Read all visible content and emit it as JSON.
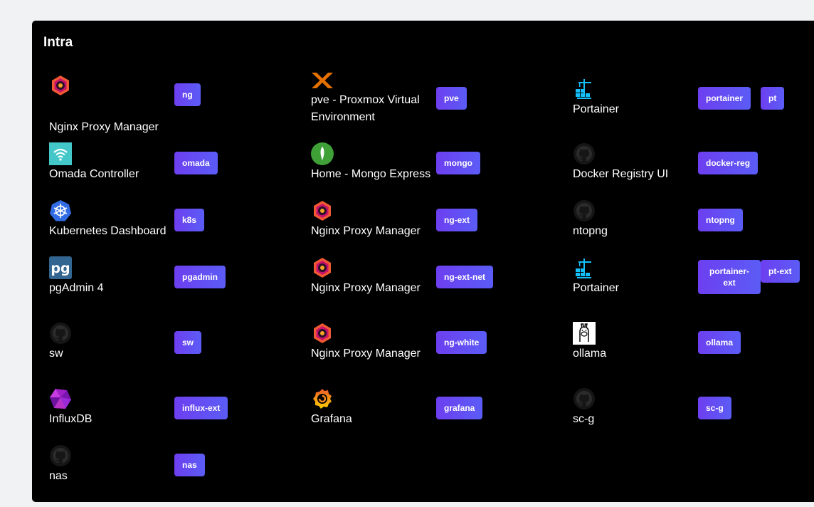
{
  "section": {
    "title": "Intra"
  },
  "apps": [
    {
      "name": "Nginx Proxy Manager",
      "icon": "nginx-proxy-manager-icon",
      "tags": [
        "ng"
      ]
    },
    {
      "name": "pve - Proxmox Virtual Environment",
      "icon": "proxmox-icon",
      "tags": [
        "pve"
      ]
    },
    {
      "name": "Portainer",
      "icon": "portainer-icon",
      "tags": [
        "portainer",
        "pt"
      ]
    },
    {
      "name": "Omada Controller",
      "icon": "omada-wifi-icon",
      "tags": [
        "omada"
      ]
    },
    {
      "name": "Home - Mongo Express",
      "icon": "mongodb-leaf-icon",
      "tags": [
        "mongo"
      ]
    },
    {
      "name": "Docker Registry UI",
      "icon": "github-icon",
      "tags": [
        "docker-reg"
      ]
    },
    {
      "name": "Kubernetes Dashboard",
      "icon": "kubernetes-icon",
      "tags": [
        "k8s"
      ]
    },
    {
      "name": "Nginx Proxy Manager",
      "icon": "nginx-proxy-manager-icon",
      "tags": [
        "ng-ext"
      ]
    },
    {
      "name": "ntopng",
      "icon": "github-icon",
      "tags": [
        "ntopng"
      ]
    },
    {
      "name": "pgAdmin 4",
      "icon": "pgadmin-icon",
      "tags": [
        "pgadmin"
      ]
    },
    {
      "name": "Nginx Proxy Manager",
      "icon": "nginx-proxy-manager-icon",
      "tags": [
        "ng-ext-net"
      ]
    },
    {
      "name": "Portainer",
      "icon": "portainer-icon",
      "tags": [
        "portainer-ext",
        "pt-ext"
      ]
    },
    {
      "name": "sw",
      "icon": "github-icon",
      "tags": [
        "sw"
      ]
    },
    {
      "name": "Nginx Proxy Manager",
      "icon": "nginx-proxy-manager-icon",
      "tags": [
        "ng-white"
      ]
    },
    {
      "name": "ollama",
      "icon": "ollama-llama-icon",
      "tags": [
        "ollama"
      ]
    },
    {
      "name": "InfluxDB",
      "icon": "influxdb-icon",
      "tags": [
        "influx-ext"
      ]
    },
    {
      "name": "Grafana",
      "icon": "grafana-icon",
      "tags": [
        "grafana"
      ]
    },
    {
      "name": "sc-g",
      "icon": "github-icon",
      "tags": [
        "sc-g"
      ]
    },
    {
      "name": "nas",
      "icon": "github-icon",
      "tags": [
        "nas"
      ]
    }
  ]
}
